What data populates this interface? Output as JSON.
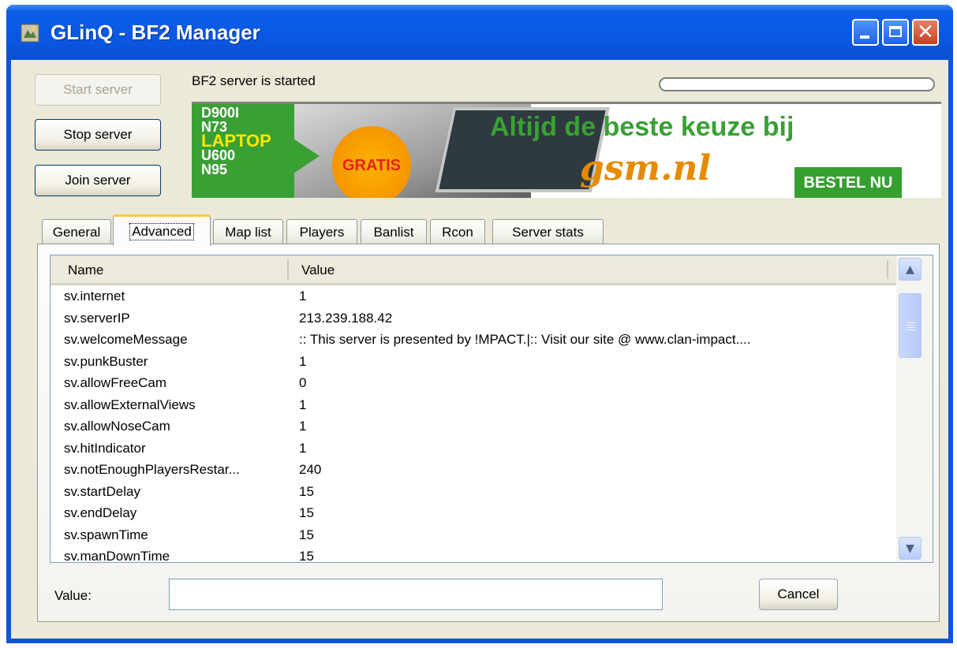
{
  "window": {
    "title": "GLinQ - BF2 Manager",
    "controls": {
      "close_glyph": "✕"
    }
  },
  "buttons": {
    "start": "Start server",
    "stop": "Stop server",
    "join": "Join server",
    "cancel": "Cancel"
  },
  "status": {
    "text": "BF2 server is started",
    "progress": 0
  },
  "banner": {
    "models": [
      "D900I",
      "N73",
      "LAPTOP",
      "U600",
      "N95"
    ],
    "badge": "GRATIS",
    "headline": "Altijd de beste keuze bij",
    "logo": "gsm.nl",
    "cta": "BESTEL NU"
  },
  "tabs": [
    "General",
    "Advanced",
    "Map list",
    "Players",
    "Banlist",
    "Rcon",
    "Server stats"
  ],
  "active_tab": "Advanced",
  "list": {
    "columns": [
      "Name",
      "Value"
    ],
    "rows": [
      [
        "sv.internet",
        "1"
      ],
      [
        "sv.serverIP",
        "213.239.188.42"
      ],
      [
        "sv.welcomeMessage",
        "::  This server is presented by !MPACT.|::  Visit our site @ www.clan-impact...."
      ],
      [
        "sv.punkBuster",
        "1"
      ],
      [
        "sv.allowFreeCam",
        "0"
      ],
      [
        "sv.allowExternalViews",
        "1"
      ],
      [
        "sv.allowNoseCam",
        "1"
      ],
      [
        "sv.hitIndicator",
        "1"
      ],
      [
        "sv.notEnoughPlayersRestar...",
        "240"
      ],
      [
        "sv.startDelay",
        "15"
      ],
      [
        "sv.endDelay",
        "15"
      ],
      [
        "sv.spawnTime",
        "15"
      ],
      [
        "sv.manDownTime",
        "15"
      ]
    ],
    "scroll": {
      "up": "▲",
      "down": "▼"
    }
  },
  "editor": {
    "label": "Value:",
    "value": ""
  }
}
